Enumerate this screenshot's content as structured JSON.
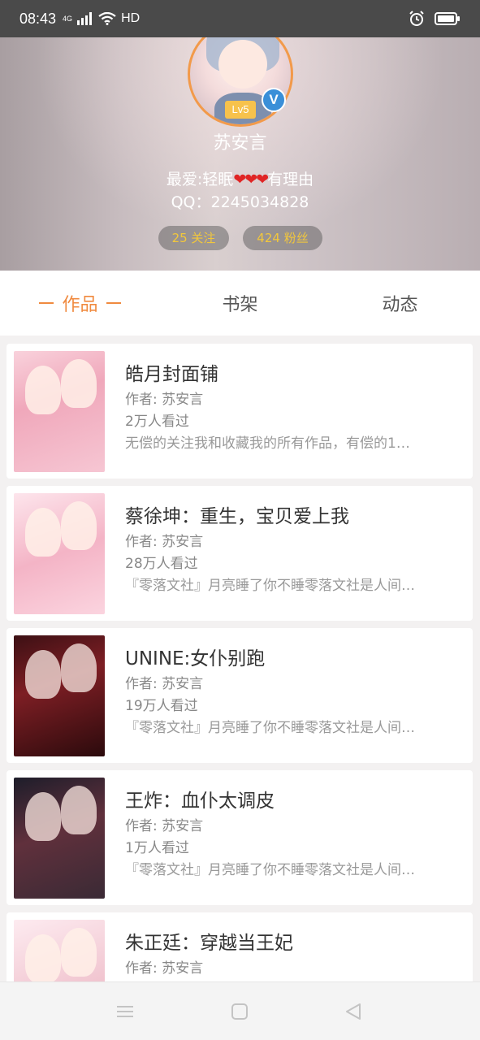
{
  "status_bar": {
    "time": "08:43",
    "network": "4G",
    "hd": "HD"
  },
  "profile": {
    "level": "Lv5",
    "verified_mark": "V",
    "name": "苏安言",
    "bio_prefix": "最爱:轻眠",
    "bio_hearts": "❤❤❤",
    "bio_suffix": "有理由",
    "qq": "QQ：2245034828",
    "following": "25 关注",
    "fans": "424 粉丝"
  },
  "tabs": [
    {
      "label": "作品",
      "active": true
    },
    {
      "label": "书架",
      "active": false
    },
    {
      "label": "动态",
      "active": false
    }
  ],
  "works": [
    {
      "title": "皓月封面铺",
      "author": "作者: 苏安言",
      "views": "2万人看过",
      "desc": "无偿的关注我和收藏我的所有作品，有偿的1…"
    },
    {
      "title": "蔡徐坤：重生，宝贝爱上我",
      "author": "作者: 苏安言",
      "views": "28万人看过",
      "desc": "『零落文社』月亮睡了你不睡零落文社是人间…"
    },
    {
      "title": "UNINE:女仆别跑",
      "author": "作者: 苏安言",
      "views": "19万人看过",
      "desc": "『零落文社』月亮睡了你不睡零落文社是人间…"
    },
    {
      "title": "王炸：血仆太调皮",
      "author": "作者: 苏安言",
      "views": "1万人看过",
      "desc": "『零落文社』月亮睡了你不睡零落文社是人间…"
    },
    {
      "title": "朱正廷：穿越当王妃",
      "author": "作者: 苏安言",
      "views": "",
      "desc": ""
    }
  ],
  "colors": {
    "accent": "#f08a3f",
    "pill_text": "#f2c73c",
    "level_badge": "#f7c24c",
    "verified": "#3a8fd8"
  }
}
